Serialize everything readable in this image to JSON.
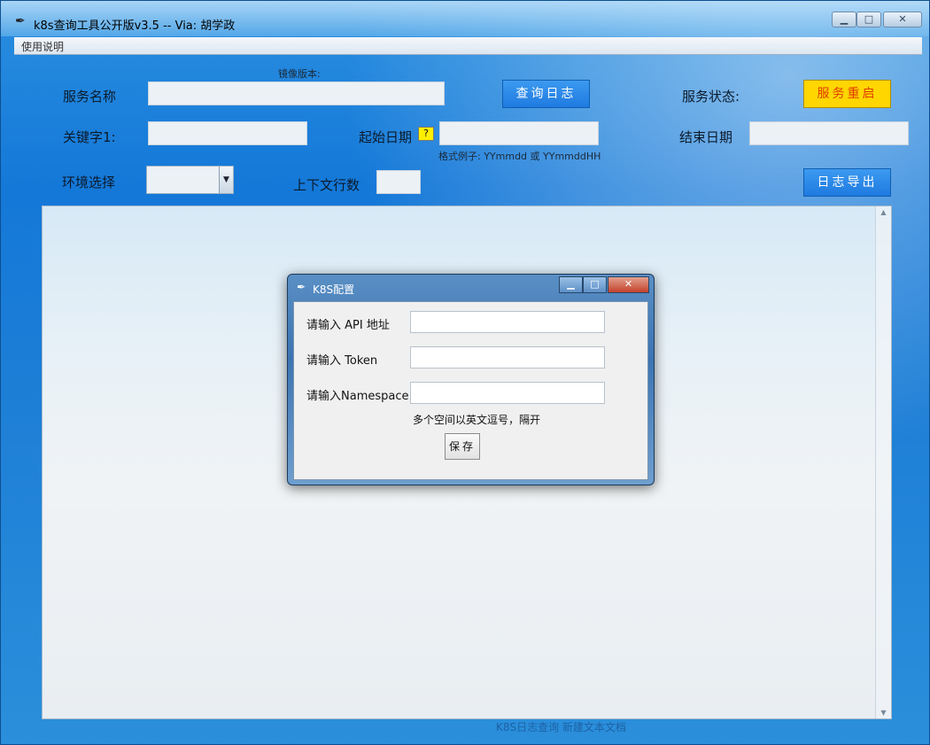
{
  "window": {
    "title": "k8s查询工具公开版v3.5 -- Via: 胡学政",
    "controls": {
      "minimize": "▁",
      "maximize": "□",
      "close": "✕"
    }
  },
  "menu": {
    "help_label": "使用说明"
  },
  "form": {
    "image_version_label": "镜像版本:",
    "service_name_label": "服务名称",
    "query_button": "查询日志",
    "service_status_label": "服务状态:",
    "restart_button": "服务重启",
    "keyword_label": "关键字1:",
    "start_date_label": "起始日期",
    "help_marker": "?",
    "date_format_hint": "格式例子: YYmmdd 或 YYmmddHH",
    "end_date_label": "结束日期",
    "env_label": "环境选择",
    "context_lines_label": "上下文行数",
    "export_button": "日志导出",
    "service_name_value": "",
    "keyword_value": "",
    "start_date_value": "",
    "end_date_value": "",
    "env_value": "",
    "context_lines_value": ""
  },
  "dialog": {
    "title": "K8S配置",
    "api_label": "请输入 API 地址",
    "token_label": "请输入 Token",
    "namespace_label": "请输入Namespace",
    "namespace_hint": "多个空间以英文逗号，隔开",
    "save_button": "保存",
    "api_value": "",
    "token_value": "",
    "namespace_value": ""
  },
  "watermark": "K8S日志查询 新建文本文档"
}
